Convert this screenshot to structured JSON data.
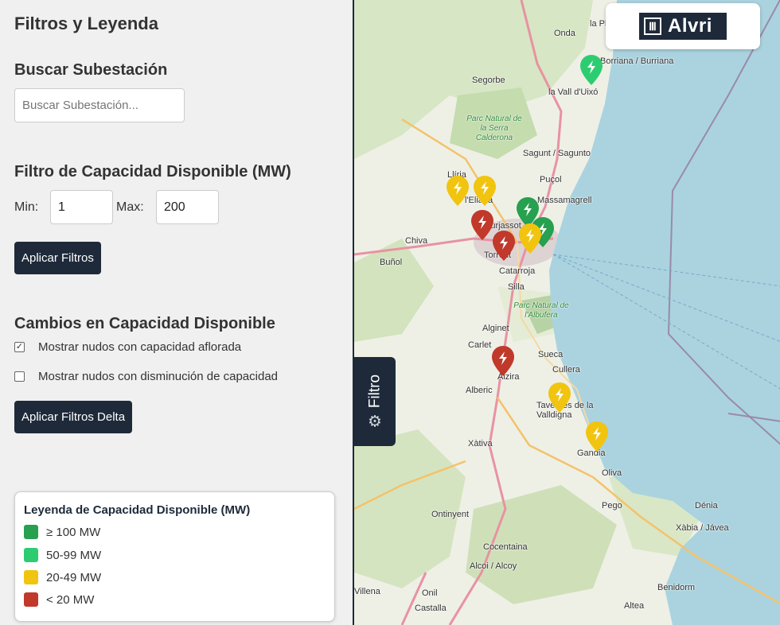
{
  "sidebar": {
    "title": "Filtros y Leyenda",
    "search": {
      "heading": "Buscar Subestación",
      "placeholder": "Buscar Subestación...",
      "value": ""
    },
    "capacity": {
      "heading": "Filtro de Capacidad Disponible (MW)",
      "min_label": "Min:",
      "min_value": "1",
      "max_label": "Max:",
      "max_value": "200",
      "apply_label": "Aplicar Filtros"
    },
    "delta": {
      "heading": "Cambios en Capacidad Disponible",
      "options": [
        {
          "label": "Mostrar nudos con capacidad aflorada",
          "checked": true
        },
        {
          "label": "Mostrar nudos con disminución de capacidad",
          "checked": false
        }
      ],
      "apply_label": "Aplicar Filtros Delta"
    },
    "legend": {
      "title": "Leyenda de Capacidad Disponible (MW)",
      "items": [
        {
          "label": "≥ 100 MW",
          "color": "#27a04f"
        },
        {
          "label": "50-99 MW",
          "color": "#2ecc71"
        },
        {
          "label": "20-49 MW",
          "color": "#f1c40f"
        },
        {
          "label": "< 20 MW",
          "color": "#c0392b"
        }
      ]
    }
  },
  "map": {
    "logo_text": "Alvri",
    "filter_tab_label": "Filtro",
    "places": [
      "la Pla",
      "Onda",
      "Borriana / Burriana",
      "Segorbe",
      "la Vall d'Uixó",
      "Parc Natural de la Serra Calderona",
      "Sagunt / Sagunto",
      "Puçol",
      "Llíria",
      "l'Eliana",
      "Massamagrell",
      "Chiva",
      "Burjassot",
      "Buñol",
      "Torrent",
      "Catarroja",
      "Silla",
      "Parc Natural de l'Albufera",
      "Alginet",
      "Carlet",
      "Sueca",
      "Alzira",
      "Cullera",
      "Alberic",
      "Tavernes de la Valldigna",
      "Xàtiva",
      "Gandia",
      "Oliva",
      "Pego",
      "Dénia",
      "Ontinyent",
      "Xàbia / Jávea",
      "Cocentaina",
      "Alcoi / Alcoy",
      "Benidorm",
      "Villena",
      "Onil",
      "Castalla",
      "Altea"
    ],
    "markers": [
      {
        "level": "50-99 MW",
        "color": "#2ecc71"
      },
      {
        "level": "20-49 MW",
        "color": "#f1c40f"
      },
      {
        "level": "20-49 MW",
        "color": "#f1c40f"
      },
      {
        "level": "≥ 100 MW",
        "color": "#27a04f"
      },
      {
        "level": "≥ 100 MW",
        "color": "#27a04f"
      },
      {
        "level": "< 20 MW",
        "color": "#c0392b"
      },
      {
        "level": "< 20 MW",
        "color": "#c0392b"
      },
      {
        "level": "20-49 MW",
        "color": "#f1c40f"
      },
      {
        "level": "< 20 MW",
        "color": "#c0392b"
      },
      {
        "level": "20-49 MW",
        "color": "#f1c40f"
      },
      {
        "level": "20-49 MW",
        "color": "#f1c40f"
      }
    ]
  }
}
